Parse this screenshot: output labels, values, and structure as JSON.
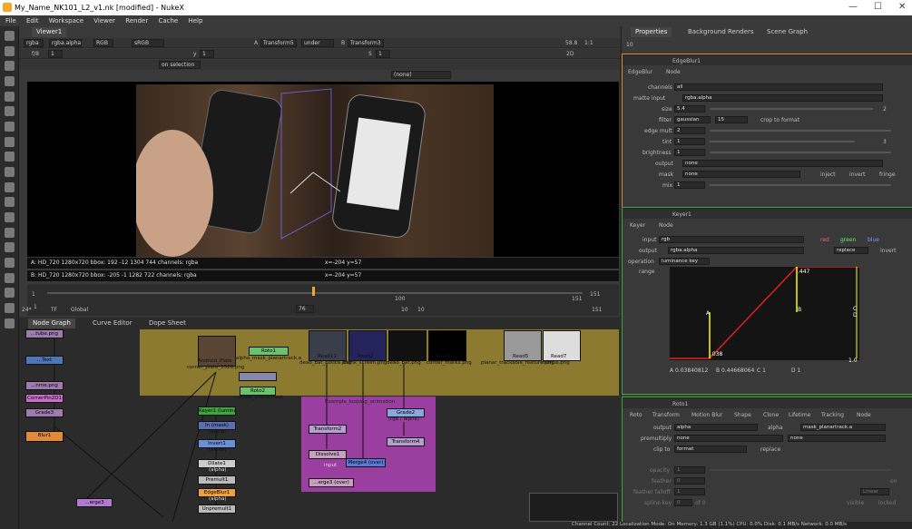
{
  "window": {
    "title": "My_Name_NK101_L2_v1.nk [modified] - NukeX",
    "min": "—",
    "max": "☐",
    "close": "✕"
  },
  "menu": [
    "File",
    "Edit",
    "Workspace",
    "Viewer",
    "Render",
    "Cache",
    "Help"
  ],
  "viewer": {
    "tab": "Viewer1",
    "channels": "rgba",
    "alpha": "rgba.alpha",
    "rgb": "RGB",
    "colorspace": "sRGB",
    "a_label": "A",
    "a_input": "Transform5",
    "wipe": "under",
    "b_label": "B",
    "b_input": "Transform3",
    "zoom": "58.8",
    "ratio": "1:1",
    "fstop": "f/8",
    "frame_field": "1",
    "y_label": "y",
    "y_value": "1",
    "s_label": "S",
    "s_value": "1",
    "view_mode": "2D",
    "on_selection": "on selection",
    "none_sel": "(none)",
    "info_a": "A:  HD_720 1280x720  bbox: 192 -12 1304 744 channels: rgba",
    "info_a_coords": "x=-204 y=57",
    "info_b": "B:  HD_720 1280x720  bbox: -205 -1 1282 722 channels: rgba",
    "info_b_coords": "x=-204 y=57",
    "timeline": {
      "start": "1",
      "end": "151",
      "current": "76",
      "fps": "24*",
      "tf": "TF",
      "global": "Global",
      "mark100": "100",
      "mark1": "1",
      "end2": "151",
      "inc": "10",
      "inc2": "10"
    }
  },
  "nodegraph_tabs": [
    "Node Graph",
    "Curve Editor",
    "Dope Sheet"
  ],
  "nodes": {
    "youtube": "...tube.png",
    "text1": "...Text",
    "read_a": "...nme.png",
    "comp": "CornerPin2D1",
    "grade3": "Grade3",
    "blur1": "Blur1",
    "android": "Android_Plate",
    "android2": "corner_plate_1528.png",
    "roto1": "Roto1",
    "roto1sub": "alpha_mask_planartrack.a",
    "roto2": "Roto2",
    "roto2sub": "...mask_planartrack",
    "keyer1": "Keyer1 (luminance key)",
    "in_mask": "In (mask)",
    "in_sub": "(alpha)",
    "invert1": "Invert1",
    "invert_sub": "(alpha)",
    "dilate1": "Dilate1",
    "dilate_sub": "(alpha)",
    "premult1": "Premult1",
    "edgeblur1": "EdgeBlur1",
    "edgeblur_sub": "(alpha)",
    "premult2": "Unpremult1",
    "read11": "Read11",
    "read11b": "dead_bat_notice.png",
    "read2": "Read2",
    "read2b": "blank_screen.png",
    "read10": "Read10",
    "read10b": "dead_bat.png",
    "read1": "Read1",
    "read1b": "corner_marks.png",
    "read5": "Read5",
    "read5b": "planar_trackable_feature.png",
    "read7": "Read7",
    "read7b": "menus.png",
    "example": "Example_looping_animation",
    "transform2": "Transform2",
    "grade2": "Grade2",
    "grade2sub": "(rgb / alpha)",
    "transform4": "Transform4",
    "dissolve1": "Dissolve1",
    "merge4": "Merge4 (over)",
    "input": "input",
    "merge3": "...erge3 (over)",
    "merge_low": "...erge3"
  },
  "properties": {
    "tabs": [
      "Properties",
      "Background Renders",
      "Scene Graph"
    ],
    "count": "10",
    "edgeblur": {
      "name": "EdgeBlur1",
      "tabs": [
        "EdgeBlur",
        "Node"
      ],
      "channels_l": "channels",
      "channels": "all",
      "matte_l": "matte input",
      "matte": "rgba.alpha",
      "size_l": "size",
      "size": "5.4",
      "size_n": "2",
      "filter_l": "filter",
      "filter": "gaussian",
      "filter_n": "15",
      "crop": "crop to format",
      "edge_l": "edge mult",
      "edge": "2",
      "tint_l": "tint",
      "tint": "1",
      "tint_n": "3",
      "bright_l": "brightness",
      "bright": "1",
      "output_l": "output",
      "output": "none",
      "mask_l": "mask",
      "mask": "none",
      "inject": "inject",
      "invert": "invert",
      "fringe": "fringe",
      "mix_l": "mix",
      "mix": "1"
    },
    "keyer": {
      "name": "Keyer1",
      "tabs": [
        "Keyer",
        "Node"
      ],
      "input_l": "input",
      "input": "rgb",
      "red": "red",
      "green": "green",
      "blue": "blue",
      "output_l": "output",
      "output": "rgba.alpha",
      "replace": "replace",
      "invert": "invert",
      "op_l": "operation",
      "op": "luminance key",
      "range_l": "range",
      "v447": ".447",
      "v038": ".038",
      "v10": "1.0",
      "A": "A",
      "B": "B",
      "C": "C",
      "D": "D",
      "a_val": "A 0.03840812",
      "b_val": "B 0.44668064",
      "c_val": "C 1",
      "d_val": "D 1"
    },
    "roto": {
      "name": "Roto1",
      "tabs": [
        "Roto",
        "Transform",
        "Motion Blur",
        "Shape",
        "Clone",
        "Lifetime",
        "Tracking",
        "Node"
      ],
      "output_l": "output",
      "output": "alpha",
      "alpha": "alpha",
      "mask": "mask_planartrack.a",
      "premult_l": "premultiply",
      "premult": "none",
      "none2": "none",
      "clip_l": "clip to",
      "clip": "format",
      "replace": "replace",
      "opacity_l": "opacity",
      "opacity": "1",
      "feather_l": "feather",
      "feather": "0",
      "on": "on",
      "ff_l": "feather falloff",
      "ff": "1",
      "ff_mode": "Linear",
      "spline_l": "spline key",
      "spline": "0",
      "of": "of 0",
      "visible": "visible",
      "locked": "locked"
    }
  },
  "status": "Channel Count: 22  Localization Mode: On  Memory: 1.3 GB (1.1%)  CPU: 0.0%  Disk: 0.1 MB/s  Network: 0.0 MB/s",
  "colors": {
    "accent": "#f5a623",
    "yellow_backdrop": "#8c7a31",
    "purple_backdrop": "#9a3f9f",
    "keyer_curve": "#e02020",
    "keyer_marker": "#ffff00"
  }
}
